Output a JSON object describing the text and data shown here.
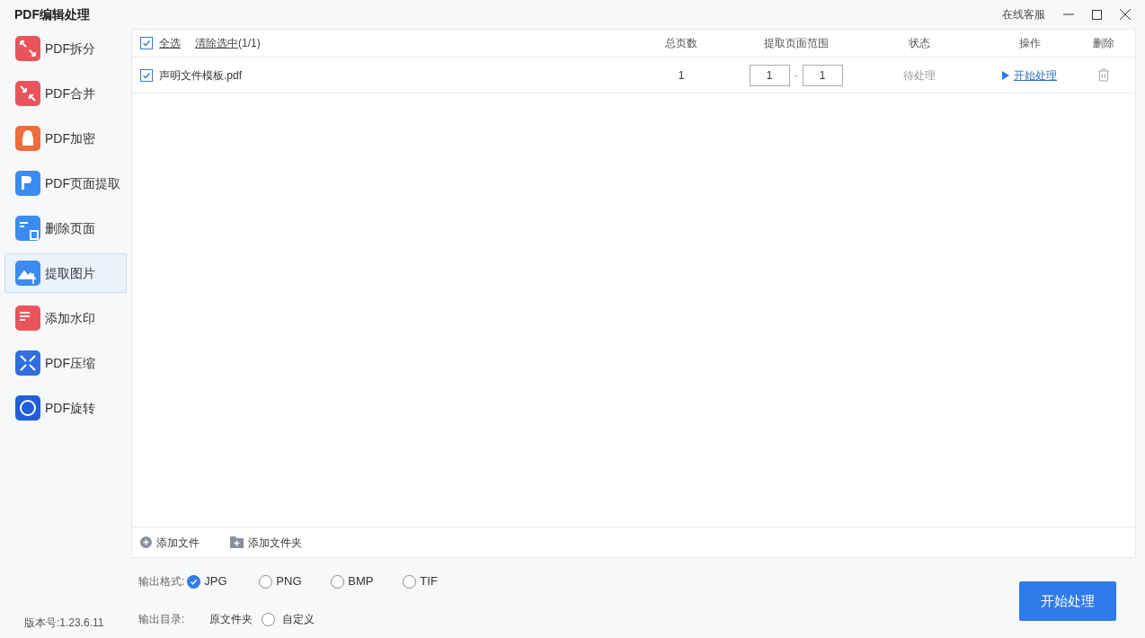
{
  "window": {
    "title": "PDF编辑处理",
    "support": "在线客服"
  },
  "sidebar": {
    "items": [
      {
        "label": "PDF拆分",
        "color": "#e9545a",
        "selected": false
      },
      {
        "label": "PDF合并",
        "color": "#e9545a",
        "selected": false
      },
      {
        "label": "PDF加密",
        "color": "#ef6c3b",
        "selected": false
      },
      {
        "label": "PDF页面提取",
        "color": "#3b8cf0",
        "selected": false
      },
      {
        "label": "删除页面",
        "color": "#3b8cf0",
        "selected": false
      },
      {
        "label": "提取图片",
        "color": "#3b8cf0",
        "selected": true
      },
      {
        "label": "添加水印",
        "color": "#e9545a",
        "selected": false
      },
      {
        "label": "PDF压缩",
        "color": "#2f6fe0",
        "selected": false
      },
      {
        "label": "PDF旋转",
        "color": "#1f5fd8",
        "selected": false
      }
    ],
    "version": "版本号:1.23.6.11"
  },
  "table": {
    "select_all": {
      "label": "全选",
      "checked": true
    },
    "clear": "清除选中",
    "count": "(1/1)",
    "columns": [
      "总页数",
      "提取页面范围",
      "状态",
      "操作",
      "删除"
    ],
    "rows": [
      {
        "checked": true,
        "name": "声明文件模板.pdf",
        "pages": "1",
        "from": "1",
        "separator": "-",
        "to": "1",
        "status": "待处理",
        "action": "开始处理"
      }
    ]
  },
  "file_actions": [
    "添加文件",
    "添加文件夹"
  ],
  "output_format": {
    "label": "输出格式:",
    "options": [
      {
        "label": "JPG",
        "selected": true
      },
      {
        "label": "PNG",
        "selected": false
      },
      {
        "label": "BMP",
        "selected": false
      },
      {
        "label": "TIF",
        "selected": false
      }
    ]
  },
  "output_dir": {
    "label": "输出目录:",
    "value": "原文件夹",
    "custom": {
      "label": "自定义",
      "selected": false
    }
  },
  "start_button": "开始处理"
}
